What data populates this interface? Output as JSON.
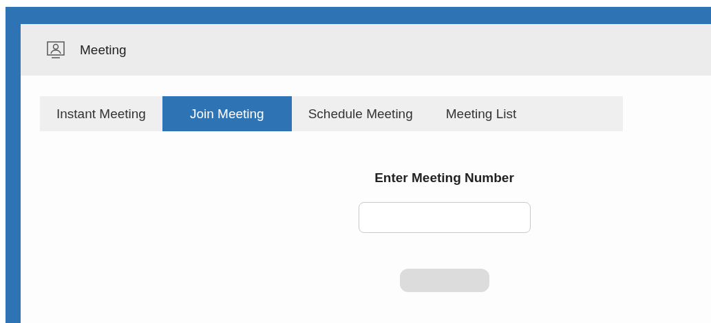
{
  "header": {
    "title": "Meeting"
  },
  "tabs": [
    {
      "label": "Instant Meeting",
      "selected": false
    },
    {
      "label": "Join Meeting",
      "selected": true
    },
    {
      "label": "Schedule Meeting",
      "selected": false
    },
    {
      "label": "Meeting List",
      "selected": false
    }
  ],
  "join_form": {
    "heading": "Enter Meeting Number",
    "number_field": {
      "disabled": false
    },
    "join_button": {
      "disabled": true
    }
  }
}
